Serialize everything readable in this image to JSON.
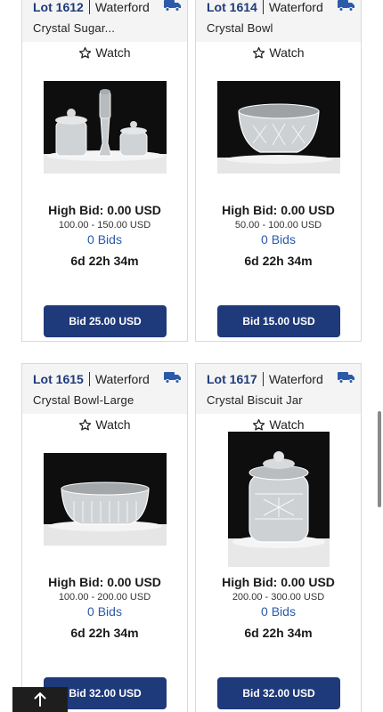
{
  "colors": {
    "accent": "#1f3a7a",
    "bid_link": "#2a5aa8",
    "header_bg": "#f4f4f4"
  },
  "lots": [
    {
      "lot": "Lot 1612",
      "brand": "Waterford",
      "title": "Crystal Sugar...",
      "watch": "Watch",
      "high_bid": "High Bid: 0.00 USD",
      "range": "100.00 - 150.00 USD",
      "bids": "0 Bids",
      "time_left": "6d 22h 34m",
      "bid_button": "Bid 25.00 USD",
      "icon": "truck-icon"
    },
    {
      "lot": "Lot 1614",
      "brand": "Waterford",
      "title": "Crystal Bowl",
      "watch": "Watch",
      "high_bid": "High Bid: 0.00 USD",
      "range": "50.00 - 100.00 USD",
      "bids": "0 Bids",
      "time_left": "6d 22h 34m",
      "bid_button": "Bid 15.00 USD",
      "icon": "truck-icon"
    },
    {
      "lot": "Lot 1615",
      "brand": "Waterford",
      "title": "Crystal Bowl-Large",
      "watch": "Watch",
      "high_bid": "High Bid: 0.00 USD",
      "range": "100.00 - 200.00 USD",
      "bids": "0 Bids",
      "time_left": "6d 22h 34m",
      "bid_button": "Bid 32.00 USD",
      "icon": "truck-icon"
    },
    {
      "lot": "Lot 1617",
      "brand": "Waterford",
      "title": "Crystal Biscuit Jar",
      "watch": "Watch",
      "high_bid": "High Bid: 0.00 USD",
      "range": "200.00 - 300.00 USD",
      "bids": "0 Bids",
      "time_left": "6d 22h 34m",
      "bid_button": "Bid 32.00 USD",
      "icon": "truck-icon"
    }
  ],
  "scroll_top_icon": "arrow-up-icon"
}
